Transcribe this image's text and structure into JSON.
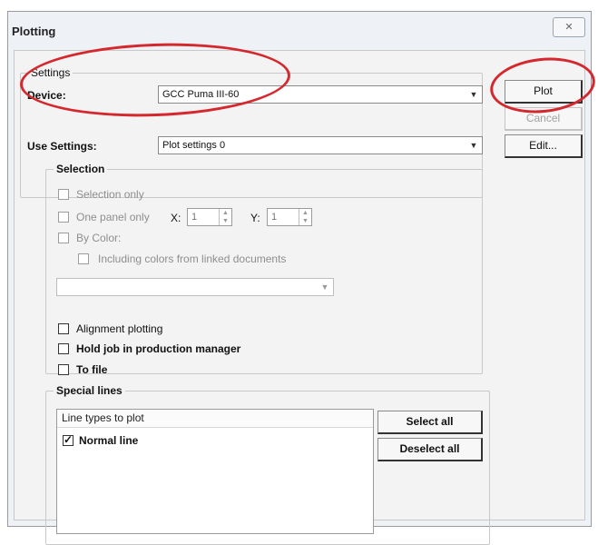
{
  "window": {
    "title": "Plotting",
    "close_label": "✕"
  },
  "settings_group": {
    "legend": "Settings"
  },
  "device": {
    "label": "Device:",
    "value": "GCC Puma III-60"
  },
  "use_settings": {
    "label": "Use Settings:",
    "value": "Plot settings 0"
  },
  "buttons": {
    "plot": "Plot",
    "cancel": "Cancel",
    "edit": "Edit..."
  },
  "selection": {
    "legend": "Selection",
    "selection_only": "Selection only",
    "one_panel_only": "One panel only",
    "x_label": "X:",
    "x_value": "1",
    "y_label": "Y:",
    "y_value": "1",
    "by_color": "By Color:",
    "including_colors": "Including colors from linked documents",
    "color_combo_value": ""
  },
  "options": {
    "alignment_plotting": "Alignment plotting",
    "hold_job": "Hold job in production manager",
    "to_file": "To file"
  },
  "special_lines": {
    "legend": "Special lines",
    "list_header": "Line types to plot",
    "items": [
      {
        "label": "Normal line",
        "checked": true
      }
    ],
    "select_all": "Select all",
    "deselect_all": "Deselect all"
  },
  "annotation": {
    "color": "#d4282e"
  }
}
